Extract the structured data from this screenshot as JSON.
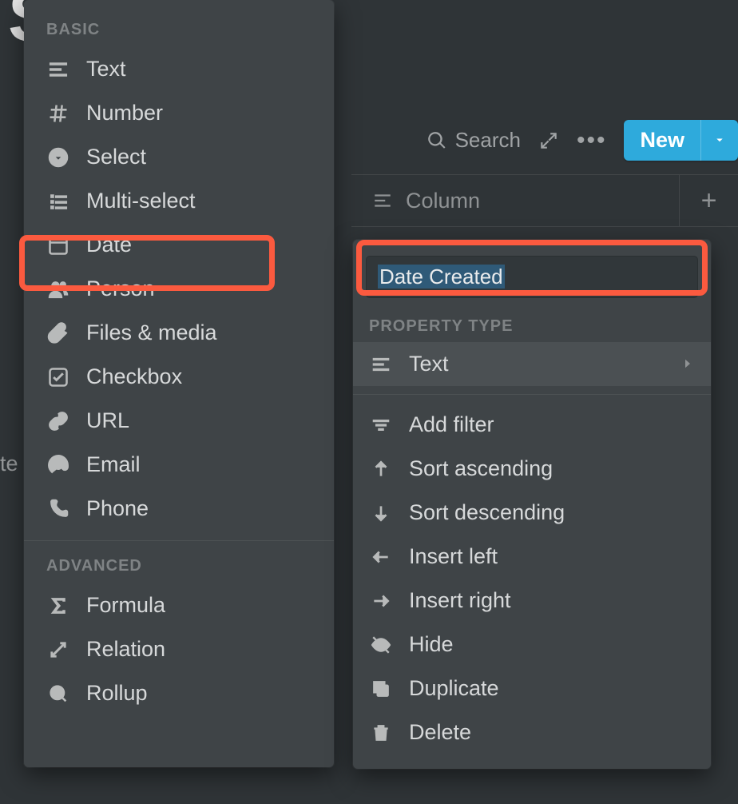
{
  "background": {
    "title_fragment": "System",
    "side_text": "te"
  },
  "toolbar": {
    "search": "Search",
    "new": "New"
  },
  "column_header": {
    "label": "Column"
  },
  "type_menu": {
    "basic_label": "BASIC",
    "advanced_label": "ADVANCED",
    "basic": [
      {
        "id": "text",
        "label": "Text"
      },
      {
        "id": "number",
        "label": "Number"
      },
      {
        "id": "select",
        "label": "Select"
      },
      {
        "id": "multi-select",
        "label": "Multi-select"
      },
      {
        "id": "date",
        "label": "Date"
      },
      {
        "id": "person",
        "label": "Person"
      },
      {
        "id": "files",
        "label": "Files & media"
      },
      {
        "id": "checkbox",
        "label": "Checkbox"
      },
      {
        "id": "url",
        "label": "URL"
      },
      {
        "id": "email",
        "label": "Email"
      },
      {
        "id": "phone",
        "label": "Phone"
      }
    ],
    "advanced": [
      {
        "id": "formula",
        "label": "Formula"
      },
      {
        "id": "relation",
        "label": "Relation"
      },
      {
        "id": "rollup",
        "label": "Rollup"
      }
    ]
  },
  "column_menu": {
    "name_value": "Date Created",
    "property_type_label": "PROPERTY TYPE",
    "current_type": "Text",
    "actions": [
      {
        "id": "add-filter",
        "label": "Add filter"
      },
      {
        "id": "sort-asc",
        "label": "Sort ascending"
      },
      {
        "id": "sort-desc",
        "label": "Sort descending"
      },
      {
        "id": "insert-left",
        "label": "Insert left"
      },
      {
        "id": "insert-right",
        "label": "Insert right"
      },
      {
        "id": "hide",
        "label": "Hide"
      },
      {
        "id": "duplicate",
        "label": "Duplicate"
      },
      {
        "id": "delete",
        "label": "Delete"
      }
    ]
  }
}
